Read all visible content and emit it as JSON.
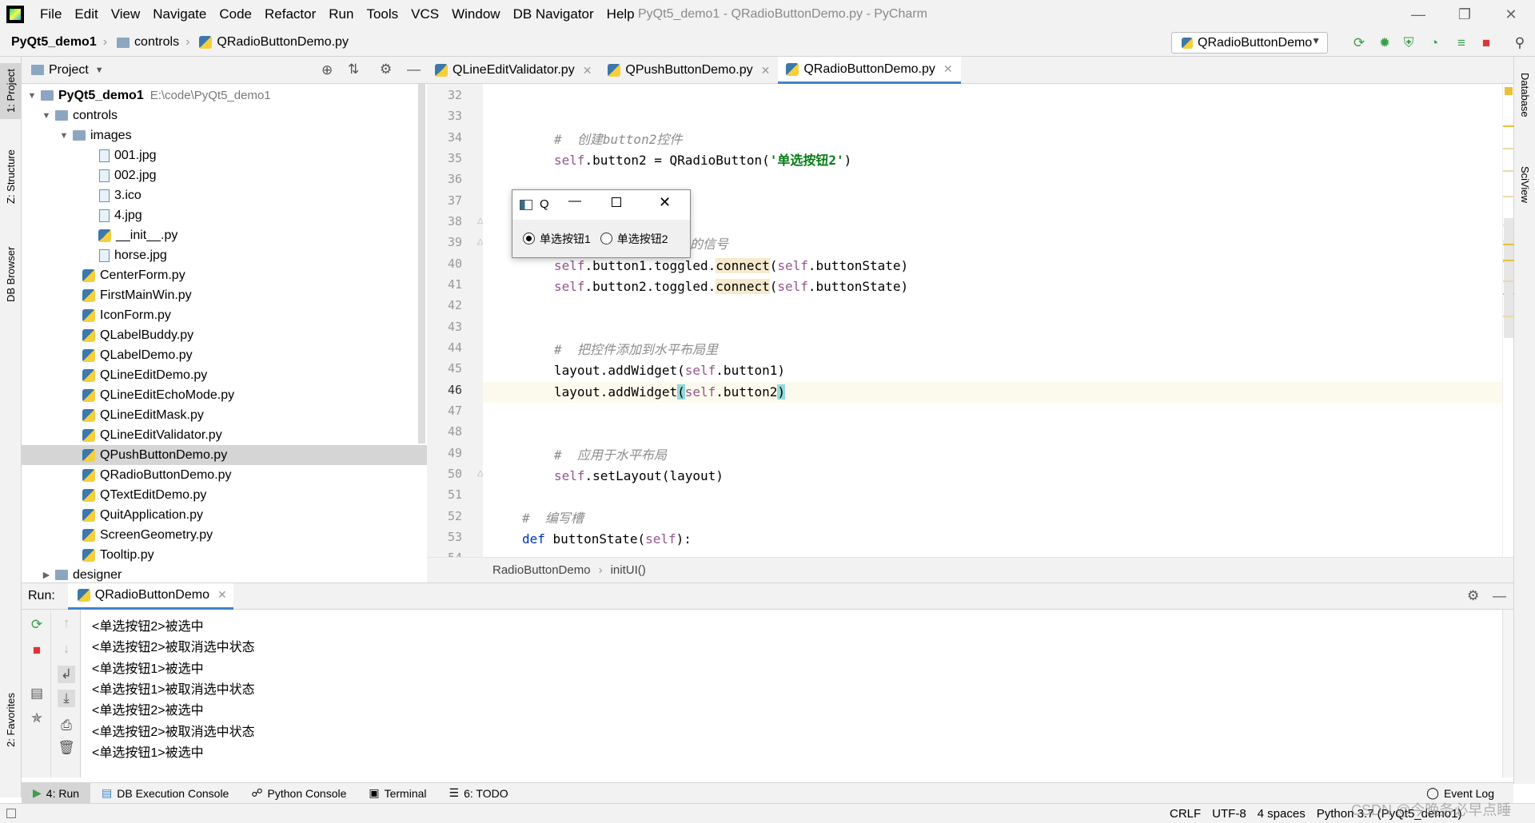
{
  "window": {
    "title": "PyQt5_demo1 - QRadioButtonDemo.py - PyCharm"
  },
  "menu": [
    "File",
    "Edit",
    "View",
    "Navigate",
    "Code",
    "Refactor",
    "Run",
    "Tools",
    "VCS",
    "Window",
    "DB Navigator",
    "Help"
  ],
  "navbar": {
    "crumbs": [
      "PyQt5_demo1",
      "controls",
      "QRadioButtonDemo.py"
    ],
    "run_config": "QRadioButtonDemo"
  },
  "left_strip": {
    "project": "1: Project",
    "structure": "Z: Structure",
    "db_browser": "DB Browser",
    "favorites": "2: Favorites"
  },
  "right_strip": {
    "database": "Database",
    "sciview": "SciView"
  },
  "project": {
    "header": "Project",
    "root": {
      "name": "PyQt5_demo1",
      "path": "E:\\code\\PyQt5_demo1"
    },
    "controls": "controls",
    "images": "images",
    "image_files": [
      "001.jpg",
      "002.jpg",
      "3.ico",
      "4.jpg",
      "__init__.py",
      "horse.jpg"
    ],
    "py_files": [
      "CenterForm.py",
      "FirstMainWin.py",
      "IconForm.py",
      "QLabelBuddy.py",
      "QLabelDemo.py",
      "QLineEditDemo.py",
      "QLineEditEchoMode.py",
      "QLineEditMask.py",
      "QLineEditValidator.py",
      "QPushButtonDemo.py",
      "QRadioButtonDemo.py",
      "QTextEditDemo.py",
      "QuitApplication.py",
      "ScreenGeometry.py",
      "Tooltip.py"
    ],
    "designer": "designer"
  },
  "tabs": [
    "QLineEditValidator.py",
    "QPushButtonDemo.py",
    "QRadioButtonDemo.py"
  ],
  "line_numbers": [
    "32",
    "33",
    "34",
    "35",
    "36",
    "37",
    "38",
    "39",
    "40",
    "41",
    "42",
    "43",
    "44",
    "45",
    "46",
    "47",
    "48",
    "49",
    "50",
    "51",
    "52",
    "53",
    "54"
  ],
  "code": {
    "l34": "#  创建button2控件",
    "l35a": "self",
    "l35b": ".button2 = QRadioButton(",
    "l35c": "'单选按钮2'",
    "l35d": ")",
    "l39": "的信号",
    "l40a": "self",
    "l40b": ".button1.toggled.",
    "l40c": "connect",
    "l40d": "(",
    "l40e": "self",
    "l40f": ".buttonState)",
    "l41a": "self",
    "l41b": ".button2.toggled.",
    "l41c": "connect",
    "l41d": "(",
    "l41e": "self",
    "l41f": ".buttonState)",
    "l44": "#  把控件添加到水平布局里",
    "l45a": "layout.addWidget(",
    "l45b": "self",
    "l45c": ".button1)",
    "l46a": "layout.addWidget",
    "l46b": "(",
    "l46c": "self",
    "l46d": ".button2",
    "l46e": ")",
    "l49": "#  应用于水平布局",
    "l50a": "self",
    "l50b": ".setLayout(layout)",
    "l53": "#  编写槽",
    "l54a": "def",
    "l54b": " buttonState(",
    "l54c": "self",
    "l54d": "):"
  },
  "editor_breadcrumb": [
    "RadioButtonDemo",
    "initUI()"
  ],
  "dialog": {
    "title": "Q",
    "radio1": "单选按钮1",
    "radio2": "单选按钮2",
    "radio1_checked": true
  },
  "run": {
    "label": "Run:",
    "tab": "QRadioButtonDemo"
  },
  "console": [
    "<单选按钮2>被选中",
    "<单选按钮2>被取消选中状态",
    "<单选按钮1>被选中",
    "<单选按钮1>被取消选中状态",
    "<单选按钮2>被选中",
    "<单选按钮2>被取消选中状态",
    "<单选按钮1>被选中"
  ],
  "bottom_tabs": [
    "4: Run",
    "DB Execution Console",
    "Python Console",
    "Terminal",
    "6: TODO"
  ],
  "event_log": "Event Log",
  "status": {
    "crlf": "CRLF",
    "encoding": "UTF-8",
    "indent": "4 spaces",
    "interpreter": "Python 3.7 (PyQt5_demo1)",
    "watermark": "CSDN @今晚务必早点睡"
  }
}
